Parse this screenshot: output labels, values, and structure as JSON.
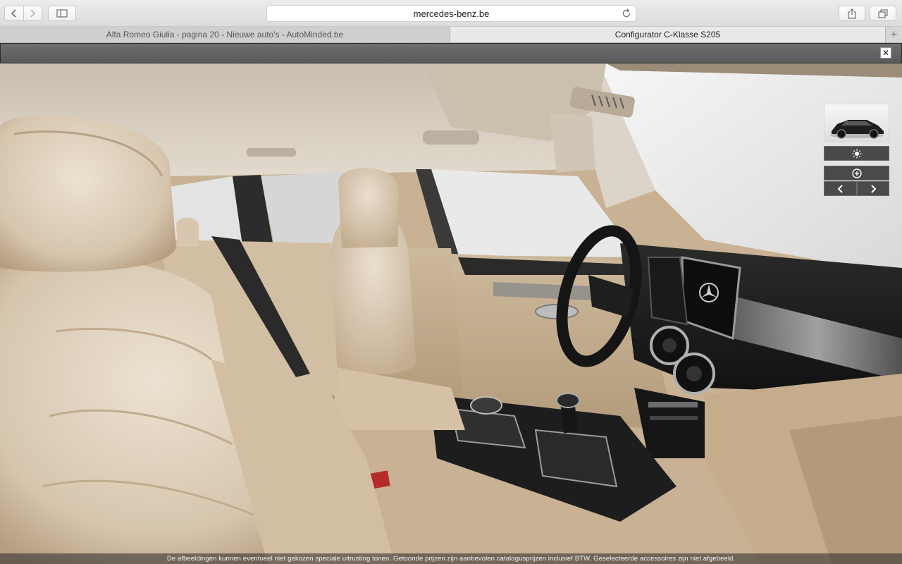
{
  "browser": {
    "url": "mercedes-benz.be",
    "tabs": [
      {
        "title": "Alfa Romeo Giulia - pagina 20 - Nieuwe auto's - AutoMinded.be",
        "active": false
      },
      {
        "title": "Configurator C-Klasse S205",
        "active": true
      }
    ],
    "icons": {
      "back": "chevron-left-icon",
      "forward": "chevron-right-icon",
      "sidebar": "sidebar-icon",
      "reload": "reload-icon",
      "share": "share-icon",
      "tabs": "tabs-overview-icon",
      "new_tab": "plus-icon"
    }
  },
  "overlay": {
    "close_label": "✕"
  },
  "viewer": {
    "light_icon": "sun-icon",
    "zoom_icon": "zoom-plus-icon",
    "prev_icon": "chevron-left-icon",
    "next_icon": "chevron-right-icon"
  },
  "disclaimer": "De afbeeldingen kunnen eventueel niet gekozen speciale uitrusting tonen. Getoonde prijzen zijn aanbevolen catalogusprijzen inclusief BTW. Geselecteerde accessoires zijn niet afgebeeld.",
  "colors": {
    "leather": "#d9c7ad",
    "leather_shadow": "#a68d6d",
    "headliner": "#cfc4b6",
    "dashboard": "#1c1c1c"
  }
}
